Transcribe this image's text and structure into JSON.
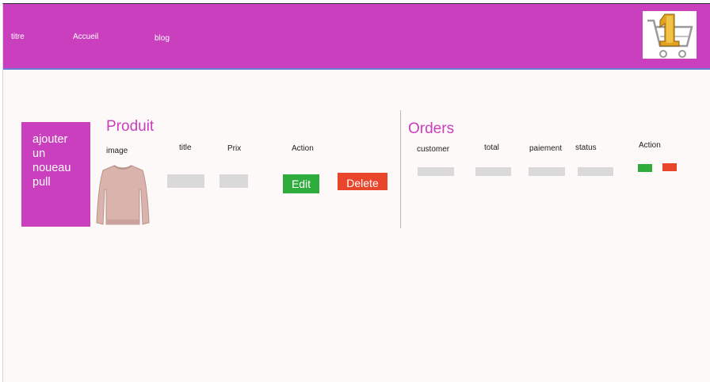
{
  "header": {
    "nav": [
      "titre",
      "Accueil",
      "blog"
    ],
    "cart_icon": "shopping-cart-icon",
    "cart_badge": "1",
    "bg_color": "#c93fbd"
  },
  "add_button": {
    "label": "ajouter un noueau pull"
  },
  "products": {
    "title": "Produit",
    "columns": [
      "image",
      "title",
      "Prix",
      "Action"
    ],
    "rows": [
      {
        "image": "pink-sweater",
        "edit_label": "Edit",
        "delete_label": "Delete"
      }
    ]
  },
  "orders": {
    "title": "Orders",
    "columns": [
      "customer",
      "total",
      "paiement",
      "status",
      "Action"
    ]
  },
  "colors": {
    "accent": "#c93fbd",
    "edit": "#2eac3c",
    "delete": "#e8452a"
  }
}
